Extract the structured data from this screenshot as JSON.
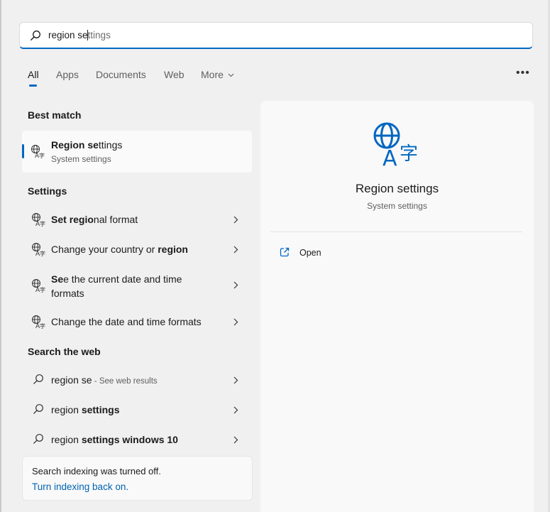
{
  "search": {
    "query_typed": "region se",
    "query_before_caret": "region se",
    "query_suggestion": "ttings",
    "icon": "search-icon"
  },
  "tabs": [
    {
      "label": "All",
      "active": true
    },
    {
      "label": "Apps",
      "active": false
    },
    {
      "label": "Documents",
      "active": false
    },
    {
      "label": "Web",
      "active": false
    },
    {
      "label": "More",
      "active": false
    }
  ],
  "more_menu_icon": "ellipsis-icon",
  "best_match": {
    "heading": "Best match",
    "title_bold": "Region se",
    "title_rest": "ttings",
    "subtitle": "System settings",
    "icon": "region-language-icon"
  },
  "settings": {
    "heading": "Settings",
    "items": [
      {
        "parts": [
          {
            "t": "Set ",
            "b": true
          },
          {
            "t": "regio",
            "b": true
          },
          {
            "t": "nal format",
            "b": false
          }
        ],
        "icon": "region-language-icon"
      },
      {
        "parts": [
          {
            "t": "Change your country or ",
            "b": false
          },
          {
            "t": "region",
            "b": true
          }
        ],
        "icon": "region-language-icon"
      },
      {
        "parts": [
          {
            "t": "Se",
            "b": true
          },
          {
            "t": "e the current date and time",
            "b": false
          }
        ],
        "line2": "formats",
        "icon": "region-language-icon"
      },
      {
        "parts": [
          {
            "t": "Change the date and time formats",
            "b": false
          }
        ],
        "icon": "region-language-icon"
      }
    ]
  },
  "web": {
    "heading": "Search the web",
    "items": [
      {
        "text": "region se",
        "hint": " - See web results",
        "bold_from": -1
      },
      {
        "text_plain": "region ",
        "text_bold": "settings"
      },
      {
        "text_plain": "region ",
        "text_bold": "settings windows 10"
      }
    ]
  },
  "indexing": {
    "message": "Search indexing was turned off.",
    "link": "Turn indexing back on."
  },
  "preview": {
    "title": "Region settings",
    "subtitle": "System settings",
    "action_open": "Open",
    "open_icon": "open-external-icon"
  },
  "colors": {
    "accent": "#0067c0",
    "link": "#0063b1",
    "panel": "#f9f9f9",
    "background": "#f0f0f0"
  }
}
